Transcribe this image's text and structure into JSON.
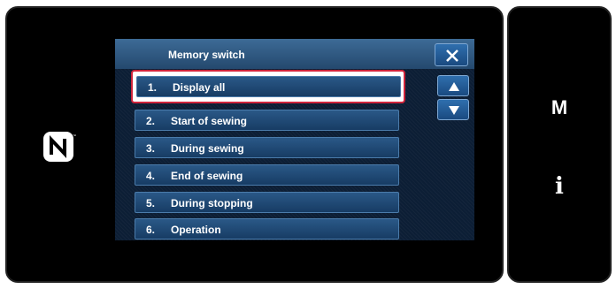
{
  "screen": {
    "title": "Memory switch",
    "items": [
      {
        "number": "1.",
        "label": "Display all",
        "selected": true
      },
      {
        "number": "2.",
        "label": "Start of sewing"
      },
      {
        "number": "3.",
        "label": "During sewing"
      },
      {
        "number": "4.",
        "label": "End of sewing"
      },
      {
        "number": "5.",
        "label": "During stopping"
      },
      {
        "number": "6.",
        "label": "Operation"
      }
    ]
  },
  "side": {
    "m_label": "M",
    "info_label": "i"
  },
  "icons": {
    "nfc": "nfc-icon",
    "close": "close-icon",
    "up": "arrow-up-icon",
    "down": "arrow-down-icon"
  },
  "colors": {
    "panel": "#000000",
    "screen": "#0c1e35",
    "button": "#1f4c7a",
    "selection": "#d0243b"
  }
}
